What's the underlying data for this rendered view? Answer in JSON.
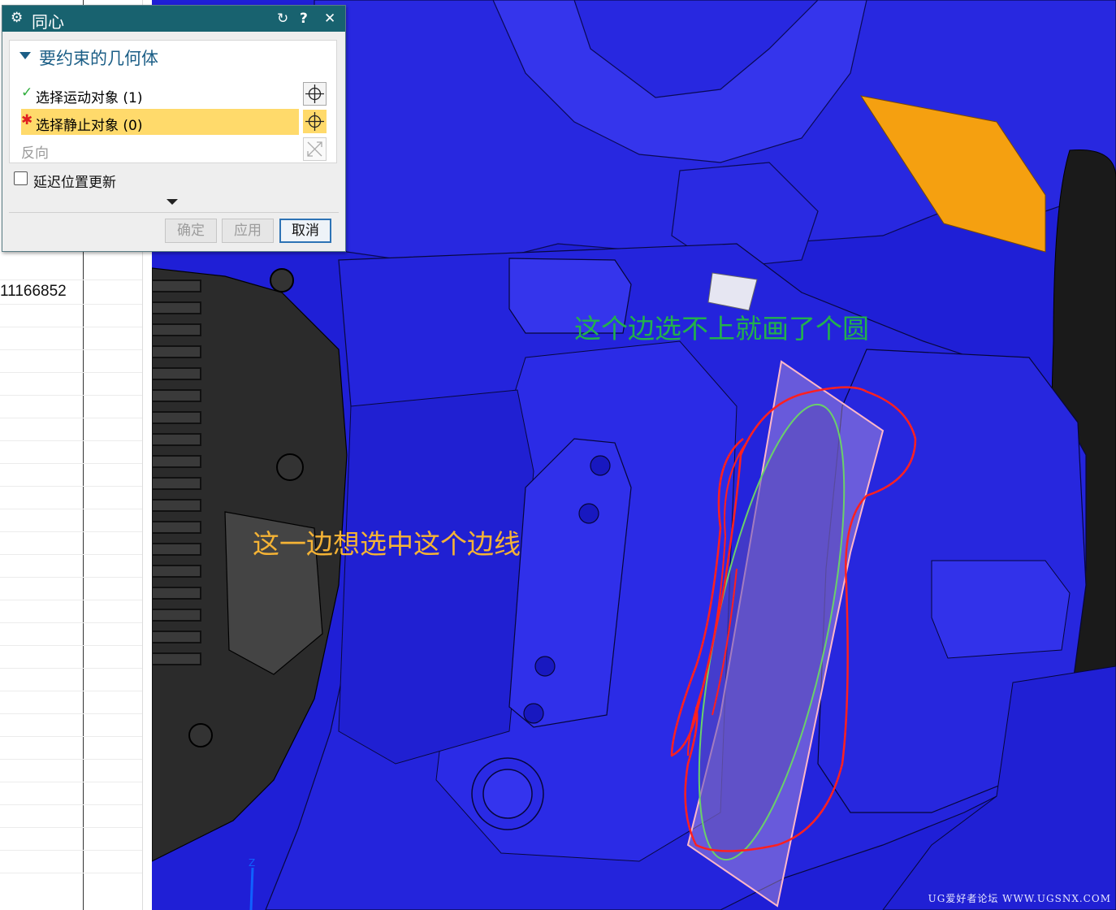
{
  "dialog": {
    "title": "同心",
    "title_icon": "gear-icon",
    "toolbar": {
      "reset": "↻",
      "help": "?",
      "close": "✕"
    },
    "group": {
      "label": "要约束的几何体",
      "rows": {
        "motion": {
          "text": "选择运动对象 (1)",
          "mark": "✓",
          "mark_color": "#2fae3c"
        },
        "static": {
          "text": "选择静止对象 (0)",
          "mark": "✱",
          "mark_color": "#e02020"
        },
        "reverse": {
          "text": "反向"
        }
      }
    },
    "delay_update": {
      "label": "延迟位置更新",
      "checked": false
    },
    "buttons": {
      "ok": "确定",
      "apply": "应用",
      "cancel": "取消"
    }
  },
  "left_panel": {
    "visible_value": "11166852"
  },
  "annotations": {
    "green": "这个边选不上就画了个圆",
    "orange": "这一边想选中这个边线"
  },
  "watermark": "UG爱好者论坛 WWW.UGSNX.COM",
  "colors": {
    "model_blue": "#1f1fd6",
    "highlight_yellow": "#ffda6b",
    "titlebar": "#18626f",
    "annotation_green": "#22b14c",
    "annotation_orange": "#f5b335",
    "sketch_red": "#ff2020"
  }
}
